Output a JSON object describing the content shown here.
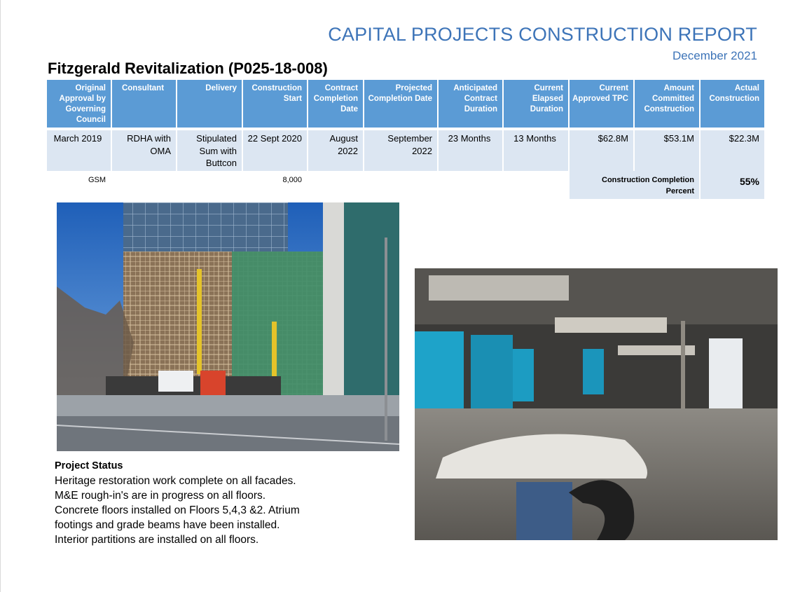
{
  "report": {
    "title": "CAPITAL PROJECTS CONSTRUCTION REPORT",
    "date": "December 2021"
  },
  "project": {
    "title": "Fitzgerald Revitalization (P025-18-008)"
  },
  "table": {
    "headers": [
      "Original Approval by Governing Council",
      "Consultant",
      "Delivery",
      "Construction Start",
      "Contract Completion Date",
      "Projected Completion Date",
      "Anticipated Contract Duration",
      "Current Elapsed Duration",
      "Current Approved TPC",
      "Amount Committed Construction",
      "Actual Construction"
    ],
    "values": [
      "March 2019",
      "RDHA with OMA",
      "Stipulated Sum with Buttcon",
      "22 Sept 2020",
      "August 2022",
      "September 2022",
      "23 Months",
      "13 Months",
      "$62.8M",
      "$53.1M",
      "$22.3M"
    ],
    "gsm_label": "GSM",
    "gsm_value": "8,000",
    "completion_label": "Construction Completion Percent",
    "completion_value": "55%"
  },
  "photos": {
    "exterior_caption_icon": "photo-exterior",
    "interior_caption_icon": "photo-interior"
  },
  "status": {
    "heading": "Project Status",
    "lines": [
      "Heritage restoration work complete on all facades.",
      "M&E rough-in's are in progress on all floors.",
      "Concrete floors installed on Floors 5,4,3 &2.  Atrium",
      "footings and grade beams have been installed.",
      "Interior partitions are installed on all floors."
    ]
  },
  "colors": {
    "title_blue": "#3d74b8",
    "header_blue": "#5b9bd5",
    "cell_shade": "#dce6f2"
  }
}
